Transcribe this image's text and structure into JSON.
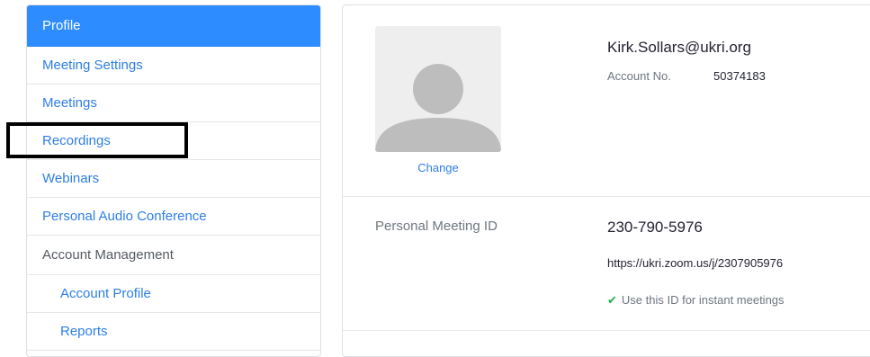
{
  "sidebar": {
    "items": [
      {
        "label": "Profile"
      },
      {
        "label": "Meeting Settings"
      },
      {
        "label": "Meetings"
      },
      {
        "label": "Recordings"
      },
      {
        "label": "Webinars"
      },
      {
        "label": "Personal Audio Conference"
      },
      {
        "label": "Account Management"
      },
      {
        "label": "Account Profile"
      },
      {
        "label": "Reports"
      }
    ]
  },
  "profile": {
    "change_label": "Change",
    "email": "Kirk.Sollars@ukri.org",
    "account_no_label": "Account No.",
    "account_no_value": "50374183"
  },
  "pmi": {
    "label": "Personal Meeting ID",
    "value": "230-790-5976",
    "url": "https://ukri.zoom.us/j/2307905976",
    "instant_text": "Use this ID for instant meetings"
  },
  "colors": {
    "accent": "#2d8cff",
    "link": "#2d7ee6",
    "check": "#23b34a",
    "highlight": "#000000"
  },
  "icons": {
    "avatar": "default-user-avatar-icon",
    "check": "checkmark-icon"
  }
}
